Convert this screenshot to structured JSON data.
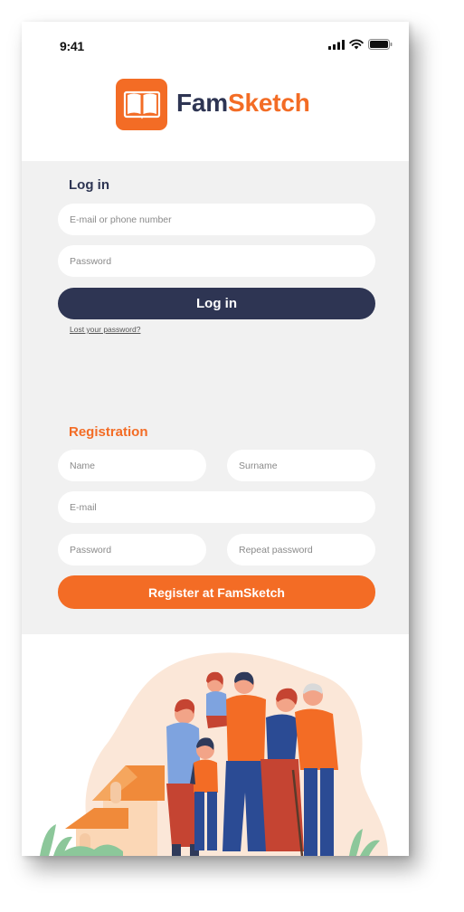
{
  "status_bar": {
    "time": "9:41"
  },
  "brand": {
    "name_part1": "Fam",
    "name_part2": "Sketch"
  },
  "login": {
    "title": "Log in",
    "email_placeholder": "E-mail or phone number",
    "password_placeholder": "Password",
    "button_label": "Log in",
    "lost_password_link": "Lost your password?"
  },
  "registration": {
    "title": "Registration",
    "name_placeholder": "Name",
    "surname_placeholder": "Surname",
    "email_placeholder": "E-mail",
    "password_placeholder": "Password",
    "repeat_password_placeholder": "Repeat password",
    "button_label": "Register at FamSketch"
  },
  "colors": {
    "brand_orange": "#f36c25",
    "navy": "#2e3553",
    "form_background": "#f1f1f1"
  },
  "icons": [
    "signal-icon",
    "wifi-icon",
    "battery-icon",
    "book-logo-icon"
  ]
}
